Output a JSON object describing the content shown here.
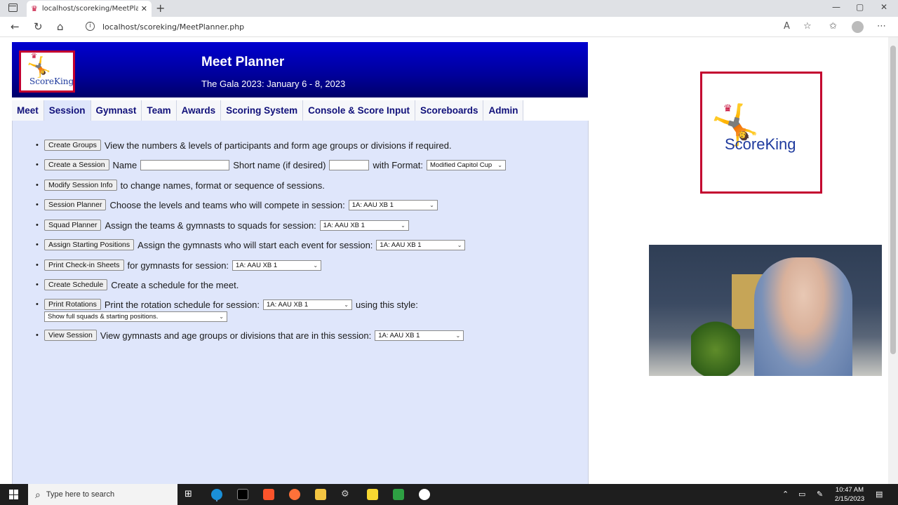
{
  "browser": {
    "tab_title": "localhost/scoreking/MeetPlanner.php",
    "url": "localhost/scoreking/MeetPlanner.php"
  },
  "header": {
    "logo_text": "ScoreKing",
    "title": "Meet Planner",
    "subtitle": "The Gala 2023: January 6 - 8, 2023"
  },
  "nav": {
    "items": [
      "Meet",
      "Session",
      "Gymnast",
      "Team",
      "Awards",
      "Scoring System",
      "Console & Score Input",
      "Scoreboards",
      "Admin"
    ],
    "active": "Session"
  },
  "rows": {
    "create_groups": {
      "button": "Create Groups",
      "text": "View the numbers & levels of participants and form age groups or divisions if required."
    },
    "create_session": {
      "button": "Create a Session",
      "name_label": "Name",
      "short_label": "Short name (if desired)",
      "format_label": "with Format:",
      "format_value": "Modified Capitol Cup"
    },
    "modify_session": {
      "button": "Modify Session Info",
      "text": "to change names, format or sequence of sessions."
    },
    "session_planner": {
      "button": "Session Planner",
      "text": "Choose the levels and teams who will compete in session:",
      "select": "1A: AAU XB 1"
    },
    "squad_planner": {
      "button": "Squad Planner",
      "text": "Assign the teams & gymnasts to squads for session:",
      "select": "1A: AAU XB 1"
    },
    "starting_positions": {
      "button": "Assign Starting Positions",
      "text": "Assign the gymnasts who will start each event for session:",
      "select": "1A: AAU XB 1"
    },
    "checkin": {
      "button": "Print Check-in Sheets",
      "text": "for gymnasts for session:",
      "select": "1A: AAU XB 1"
    },
    "schedule": {
      "button": "Create Schedule",
      "text": "Create a schedule for the meet."
    },
    "rotations": {
      "button": "Print Rotations",
      "text": "Print the rotation schedule for session:",
      "select": "1A: AAU XB 1",
      "style_label": "using this style:",
      "style_select": "Show full squads & starting positions."
    },
    "view_session": {
      "button": "View Session",
      "text": "View gymnasts and age groups or divisions that are in this session:",
      "select": "1A: AAU XB 1"
    }
  },
  "side_logo_text": "ScoreKing",
  "taskbar": {
    "search_placeholder": "Type here to search",
    "time": "10:47 AM",
    "date": "2/15/2023"
  },
  "colors": {
    "header_blue": "#0000c0",
    "content_bg": "#dfe6fb",
    "nav_text": "#10107a",
    "logo_border": "#c3002f"
  }
}
